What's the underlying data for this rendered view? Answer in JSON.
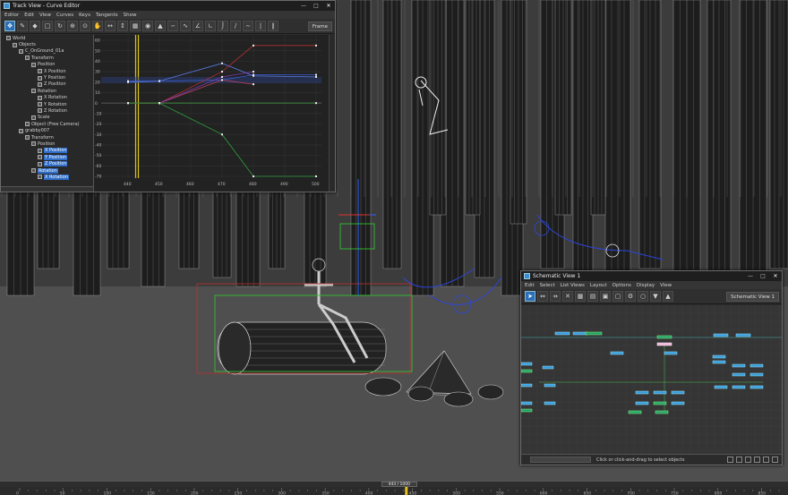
{
  "track_view": {
    "title": "Track View - Curve Editor",
    "menu": [
      "Editor",
      "Edit",
      "View",
      "Curves",
      "Keys",
      "Tangents",
      "Show"
    ],
    "toolbar_field": "Frame",
    "tree": [
      {
        "label": "World",
        "indent": 0,
        "selected": false
      },
      {
        "label": "Objects",
        "indent": 1,
        "selected": false
      },
      {
        "label": "C_OnGround_01a",
        "indent": 2,
        "selected": false
      },
      {
        "label": "Transform",
        "indent": 3,
        "selected": false
      },
      {
        "label": "Position",
        "indent": 4,
        "selected": false
      },
      {
        "label": "X Position",
        "indent": 5,
        "selected": false
      },
      {
        "label": "Y Position",
        "indent": 5,
        "selected": false
      },
      {
        "label": "Z Position",
        "indent": 5,
        "selected": false
      },
      {
        "label": "Rotation",
        "indent": 4,
        "selected": false
      },
      {
        "label": "X Rotation",
        "indent": 5,
        "selected": false
      },
      {
        "label": "Y Rotation",
        "indent": 5,
        "selected": false
      },
      {
        "label": "Z Rotation",
        "indent": 5,
        "selected": false
      },
      {
        "label": "Scale",
        "indent": 4,
        "selected": false
      },
      {
        "label": "Object (Free Camera)",
        "indent": 3,
        "selected": false
      },
      {
        "label": "grabby007",
        "indent": 2,
        "selected": false
      },
      {
        "label": "Transform",
        "indent": 3,
        "selected": false
      },
      {
        "label": "Position",
        "indent": 4,
        "selected": false
      },
      {
        "label": "X Position",
        "indent": 5,
        "selected": true
      },
      {
        "label": "Y Position",
        "indent": 5,
        "selected": true
      },
      {
        "label": "Z Position",
        "indent": 5,
        "selected": true
      },
      {
        "label": "Rotation",
        "indent": 4,
        "selected": true
      },
      {
        "label": "X Rotation",
        "indent": 5,
        "selected": true
      }
    ],
    "graph": {
      "y_ticks": [
        "60",
        "50",
        "40",
        "30",
        "20",
        "10",
        "0",
        "-10",
        "-20",
        "-30",
        "-40",
        "-50",
        "-60",
        "-70"
      ],
      "x_ticks": [
        "440",
        "450",
        "460",
        "470",
        "480",
        "490",
        "500"
      ],
      "current_frame_marker": 443
    }
  },
  "schematic_view": {
    "title": "Schematic View 1",
    "menu": [
      "Edit",
      "Select",
      "List Views",
      "Layout",
      "Options",
      "Display",
      "View"
    ],
    "toolbar_field": "Schematic View 1",
    "status": "Click or click-and-drag to select objects"
  },
  "timeline": {
    "slider": "443 / 1000",
    "current": 443,
    "total": 1000,
    "ticks": [
      "0",
      "50",
      "100",
      "150",
      "200",
      "250",
      "300",
      "350",
      "400",
      "450",
      "500",
      "550",
      "600",
      "650",
      "700",
      "750",
      "800",
      "850"
    ]
  },
  "colors": {
    "accent": "#2f6cc6",
    "grid": "#3a3a3a",
    "wire": "#bdbdbd"
  }
}
